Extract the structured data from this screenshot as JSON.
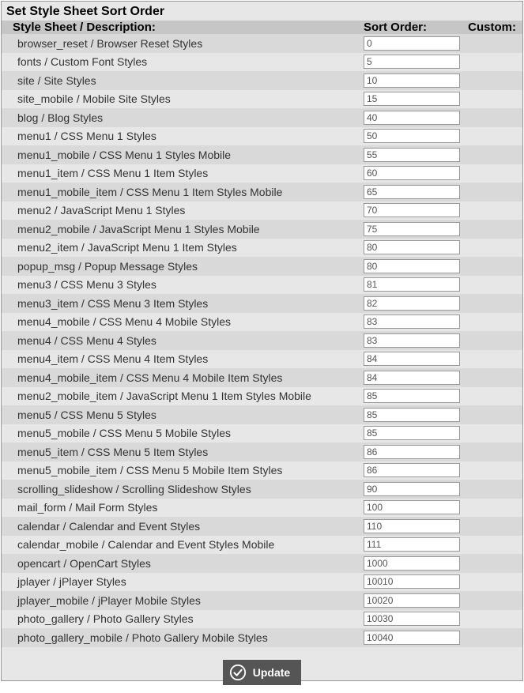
{
  "title": "Set Style Sheet Sort Order",
  "columns": {
    "desc": "Style Sheet / Description:",
    "sort": "Sort Order:",
    "custom": "Custom:"
  },
  "rows": [
    {
      "desc": "browser_reset / Browser Reset Styles",
      "sort": "0"
    },
    {
      "desc": "fonts / Custom Font Styles",
      "sort": "5"
    },
    {
      "desc": "site / Site Styles",
      "sort": "10"
    },
    {
      "desc": "site_mobile / Mobile Site Styles",
      "sort": "15"
    },
    {
      "desc": "blog / Blog Styles",
      "sort": "40"
    },
    {
      "desc": "menu1 / CSS Menu 1 Styles",
      "sort": "50"
    },
    {
      "desc": "menu1_mobile / CSS Menu 1 Styles Mobile",
      "sort": "55"
    },
    {
      "desc": "menu1_item / CSS Menu 1 Item Styles",
      "sort": "60"
    },
    {
      "desc": "menu1_mobile_item / CSS Menu 1 Item Styles Mobile",
      "sort": "65"
    },
    {
      "desc": "menu2 / JavaScript Menu 1 Styles",
      "sort": "70"
    },
    {
      "desc": "menu2_mobile / JavaScript Menu 1 Styles Mobile",
      "sort": "75"
    },
    {
      "desc": "menu2_item / JavaScript Menu 1 Item Styles",
      "sort": "80"
    },
    {
      "desc": "popup_msg / Popup Message Styles",
      "sort": "80"
    },
    {
      "desc": "menu3 / CSS Menu 3 Styles",
      "sort": "81"
    },
    {
      "desc": "menu3_item / CSS Menu 3 Item Styles",
      "sort": "82"
    },
    {
      "desc": "menu4_mobile / CSS Menu 4 Mobile Styles",
      "sort": "83"
    },
    {
      "desc": "menu4 / CSS Menu 4 Styles",
      "sort": "83"
    },
    {
      "desc": "menu4_item / CSS Menu 4 Item Styles",
      "sort": "84"
    },
    {
      "desc": "menu4_mobile_item / CSS Menu 4 Mobile Item Styles",
      "sort": "84"
    },
    {
      "desc": "menu2_mobile_item / JavaScript Menu 1 Item Styles Mobile",
      "sort": "85"
    },
    {
      "desc": "menu5 / CSS Menu 5 Styles",
      "sort": "85"
    },
    {
      "desc": "menu5_mobile / CSS Menu 5 Mobile Styles",
      "sort": "85"
    },
    {
      "desc": "menu5_item / CSS Menu 5 Item Styles",
      "sort": "86"
    },
    {
      "desc": "menu5_mobile_item / CSS Menu 5 Mobile Item Styles",
      "sort": "86"
    },
    {
      "desc": "scrolling_slideshow / Scrolling Slideshow Styles",
      "sort": "90"
    },
    {
      "desc": "mail_form / Mail Form Styles",
      "sort": "100"
    },
    {
      "desc": "calendar / Calendar and Event Styles",
      "sort": "110"
    },
    {
      "desc": "calendar_mobile / Calendar and Event Styles Mobile",
      "sort": "111"
    },
    {
      "desc": "opencart / OpenCart Styles",
      "sort": "1000"
    },
    {
      "desc": "jplayer / jPlayer Styles",
      "sort": "10010"
    },
    {
      "desc": "jplayer_mobile / jPlayer Mobile Styles",
      "sort": "10020"
    },
    {
      "desc": "photo_gallery / Photo Gallery Styles",
      "sort": "10030"
    },
    {
      "desc": "photo_gallery_mobile / Photo Gallery Mobile Styles",
      "sort": "10040"
    }
  ],
  "update_label": "Update"
}
